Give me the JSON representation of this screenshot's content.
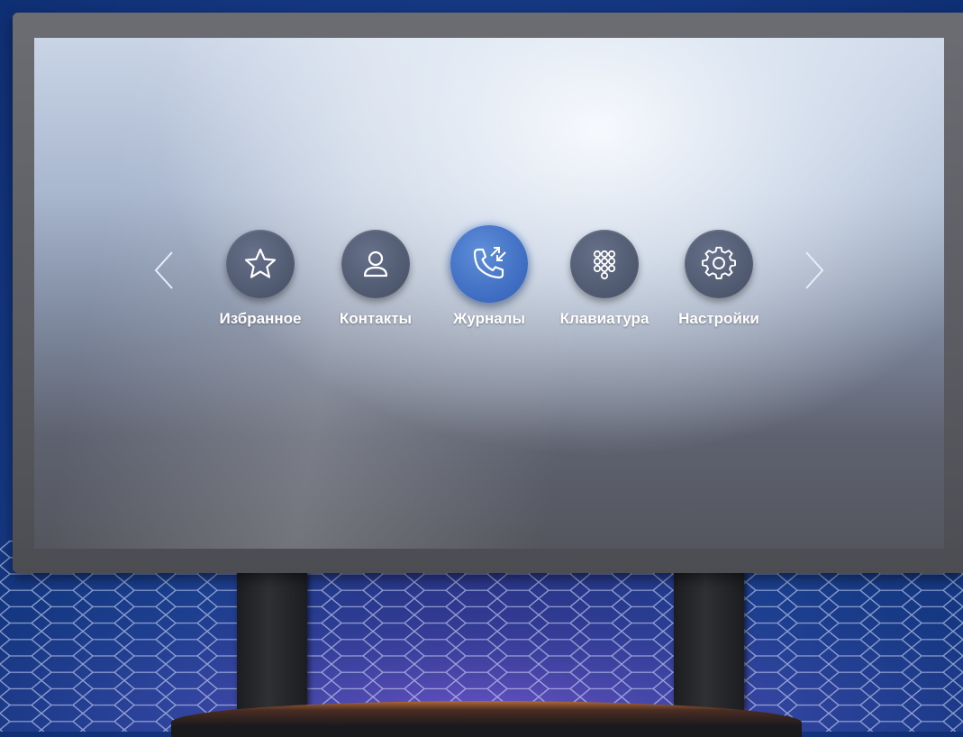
{
  "launcher": {
    "nav": {
      "prev_icon": "chevron-left-icon",
      "next_icon": "chevron-right-icon"
    },
    "apps": [
      {
        "label": "Избранное",
        "icon": "star-icon",
        "active": false
      },
      {
        "label": "Контакты",
        "icon": "person-icon",
        "active": false
      },
      {
        "label": "Журналы",
        "icon": "phone-log-icon",
        "active": true
      },
      {
        "label": "Клавиатура",
        "icon": "dialpad-icon",
        "active": false
      },
      {
        "label": "Настройки",
        "icon": "gear-icon",
        "active": false
      }
    ]
  },
  "colors": {
    "active_icon_bg": "#3f6ec3",
    "icon_bg": "#4e586e",
    "label": "#ffffff",
    "background_blue": "#1b3f8e"
  }
}
